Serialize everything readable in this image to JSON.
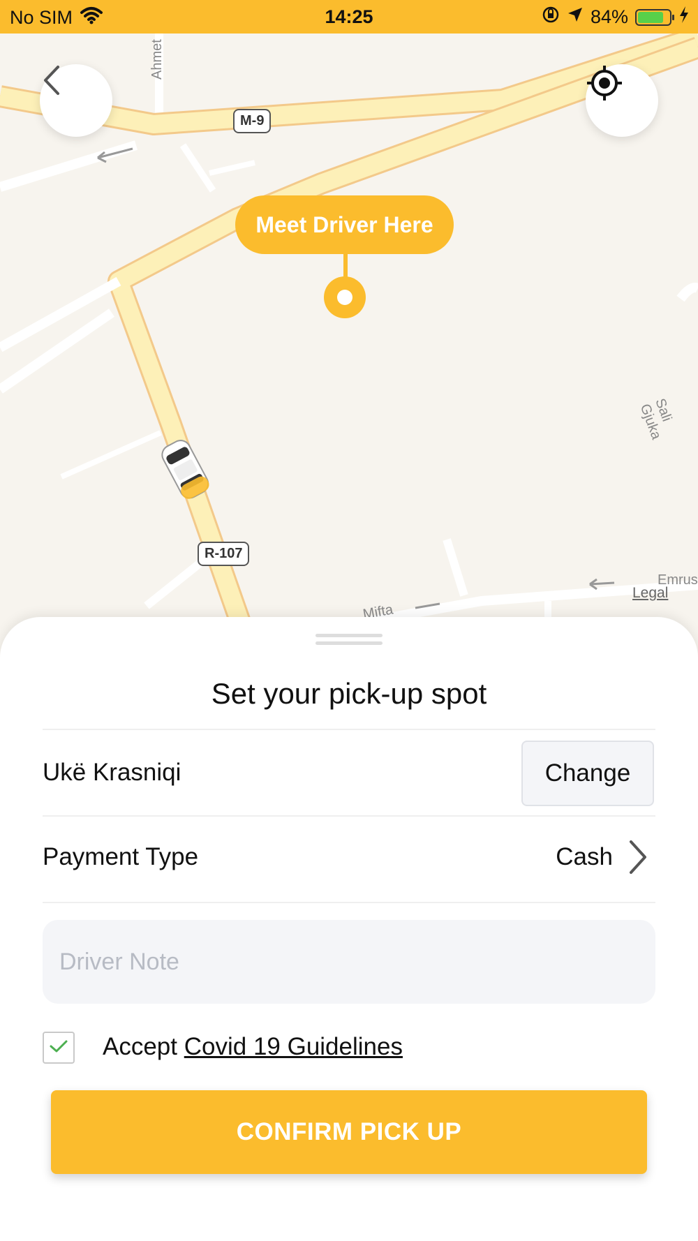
{
  "status_bar": {
    "carrier": "No SIM",
    "time": "14:25",
    "battery_percent": "84%",
    "battery_level": 0.84
  },
  "map": {
    "meet_label": "Meet Driver Here",
    "road_badges": [
      "M-9",
      "R-107"
    ],
    "street_labels": [
      "Ahmet",
      "Sali Gjuka",
      "Emrus",
      "Mifta"
    ],
    "legal": "Legal",
    "colors": {
      "accent": "#fbbc2d",
      "road": "#fdf0b8",
      "road_edge": "#f3c98a"
    },
    "icons": {
      "back": "chevron-left-icon",
      "locate": "crosshair-icon",
      "car": "taxi-car-icon"
    }
  },
  "sheet": {
    "title": "Set your pick-up spot",
    "address": "Ukë Krasniqi",
    "change_label": "Change",
    "payment_label": "Payment Type",
    "payment_value": "Cash",
    "note_placeholder": "Driver Note",
    "note_value": "",
    "accept_prefix": "Accept",
    "accept_link": "Covid 19 Guidelines",
    "accept_checked": true,
    "confirm_label": "CONFIRM PICK UP"
  }
}
